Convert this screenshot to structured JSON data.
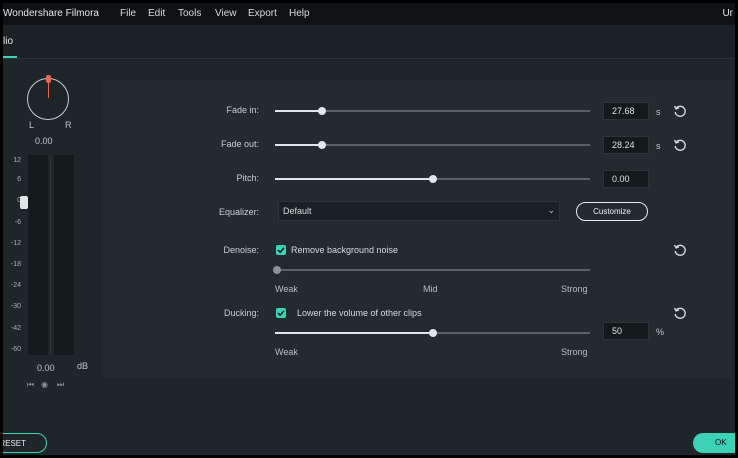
{
  "app": {
    "title": "Wondershare Filmora",
    "title_right": "Ur"
  },
  "menu": [
    "File",
    "Edit",
    "Tools",
    "View",
    "Export",
    "Help"
  ],
  "tab": {
    "label": "lio"
  },
  "meter": {
    "pan_left": "L",
    "pan_right": "R",
    "pan_value": "0.00",
    "scale": [
      "12",
      "6",
      "0",
      "-6",
      "-12",
      "-18",
      "-24",
      "-30",
      "-42",
      "-60",
      "-∞"
    ],
    "volume_value": "0.00",
    "unit": "dB",
    "transport": [
      "⏮",
      "◉",
      "⏭"
    ]
  },
  "settings": {
    "fade_in": {
      "label": "Fade in:",
      "value": "27.68",
      "unit": "s",
      "fraction": 0.15
    },
    "fade_out": {
      "label": "Fade out:",
      "value": "28.24",
      "unit": "s",
      "fraction": 0.15
    },
    "pitch": {
      "label": "Pitch:",
      "value": "0.00",
      "fraction": 0.5
    },
    "equalizer": {
      "label": "Equalizer:",
      "selected": "Default",
      "customize_label": "Customize"
    },
    "denoise": {
      "label": "Denoise:",
      "checkbox_label": "Remove background noise",
      "checked": true,
      "fraction": 0.0,
      "scale": [
        "Weak",
        "Mid",
        "Strong"
      ]
    },
    "ducking": {
      "label": "Ducking:",
      "checkbox_label": "Lower the volume of other clips",
      "checked": true,
      "value": "50",
      "unit": "%",
      "fraction": 0.5,
      "scale": [
        "Weak",
        "Strong"
      ]
    }
  },
  "footer": {
    "reset_label": "RESET",
    "ok_label": "OK"
  },
  "colors": {
    "accent": "#3dd2b6",
    "background": "#1f2629",
    "panel": "#232b2f",
    "menubar": "#0e1214",
    "pan_marker": "#e06a5a"
  }
}
